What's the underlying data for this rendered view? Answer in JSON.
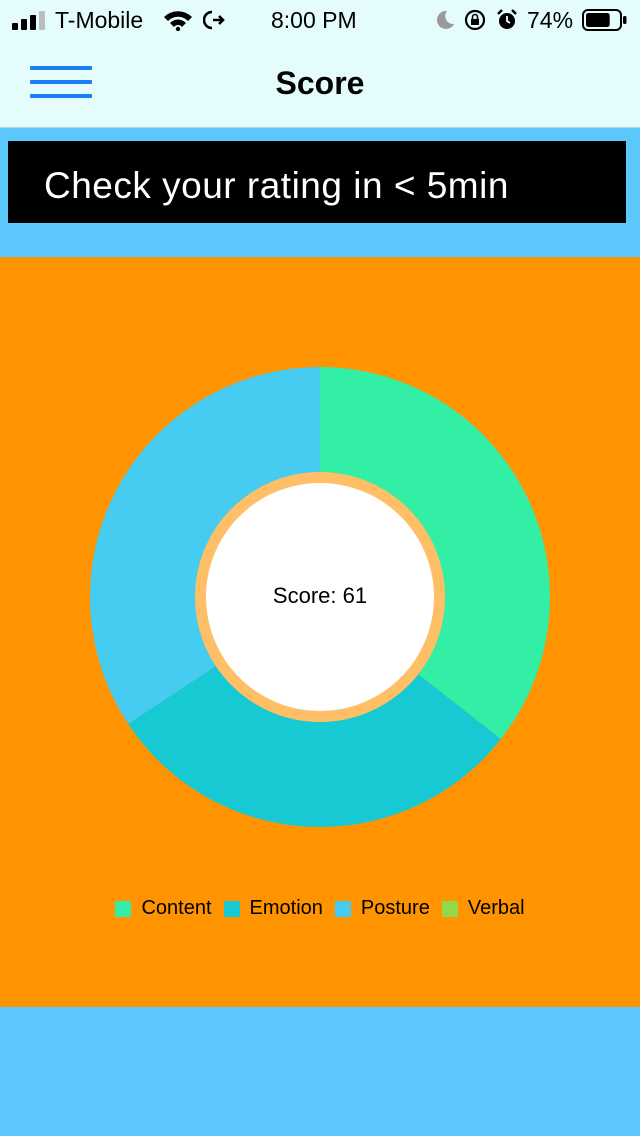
{
  "status_bar": {
    "carrier": "T-Mobile",
    "time": "8:00 PM",
    "battery": "74%",
    "battery_level": 0.74,
    "icons": [
      "signal-icon",
      "wifi-icon",
      "call-forward-icon",
      "moon-icon",
      "rotation-lock-icon",
      "alarm-icon",
      "battery-icon"
    ]
  },
  "header": {
    "title": "Score",
    "menu_icon": "hamburger-menu-icon"
  },
  "banner": {
    "text": "Check your rating in < 5min"
  },
  "colors": {
    "nav_bg": "#e4fcfc",
    "page_bg": "#5bc7fa",
    "panel_bg": "#ff9400",
    "banner_bg": "#000000",
    "accent": "#1a7ff5"
  },
  "chart": {
    "center_label": "Score: 61"
  },
  "chart_data": {
    "type": "pie",
    "donut": true,
    "categories": [
      "Content",
      "Emotion",
      "Posture",
      "Verbal"
    ],
    "values": [
      35.6,
      30.1,
      34.3,
      0
    ],
    "colors": [
      "#33eea5",
      "#16c9d3",
      "#45ccf0",
      "#8fd94a"
    ],
    "legend_position": "bottom"
  }
}
